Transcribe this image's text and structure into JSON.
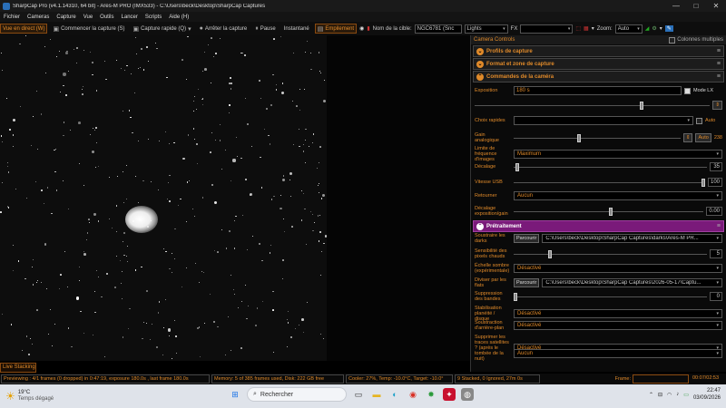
{
  "titlebar": {
    "title": "SharpCap Pro (v4.1.14310, 64 bit) - Ares-M PRO (IMX533) - C:\\Users\\beck\\Desktop\\SharpCap Captures",
    "minimize": "—",
    "maximize": "□",
    "close": "✕"
  },
  "menu": [
    "Fichier",
    "Cameras",
    "Capture",
    "Vue",
    "Outils",
    "Lancer",
    "Scripts",
    "Aide (H)"
  ],
  "toolbar": {
    "live": "Vue en direct (W)",
    "start": "Commencer la capture (S)",
    "quick": "Capture rapide (Q)",
    "stop": "Arrêter la capture",
    "pause": "Pause",
    "snapshot": "Instantané",
    "stack": "Empilement",
    "target_label": "Nom de la cible:",
    "target_value": "NGC6781 (Snc",
    "frame_type": "Lights",
    "fx_label": "FX",
    "zoom_label": "Zoom:",
    "zoom_value": "Auto"
  },
  "panel": {
    "title": "Camera Controls",
    "multi": "Colonnes multiples",
    "sections": {
      "profiles": "Profils de capture",
      "format": "Format et zone de capture",
      "camera": "Commandes de la caméra",
      "preproc": "Prétraitement"
    },
    "camera": {
      "exposure_label": "Exposition",
      "exposure_value": "180 s",
      "lx_label": "Mode LX",
      "quick_label": "Choix rapides",
      "auto_label": "Auto",
      "gain_label": "Gain analogique",
      "gain_auto": "Auto",
      "gain_value": "238",
      "framerate_label": "Limite de fréquence d'images",
      "framerate_value": "Maximum",
      "offset_label": "Décalage",
      "offset_value": "35",
      "usb_label": "Vitesse USB",
      "usb_value": "100",
      "flip_label": "Retourner",
      "flip_value": "Aucun",
      "expgain_label": "Décalage exposition/gain",
      "expgain_value": "0.00"
    },
    "preproc": {
      "darks_label": "Soustraire les darks",
      "darks_btn": "Parcourir",
      "darks_path": "C:\\Users\\beck\\Desktop\\SharpCap Captures\\darks\\Ares-M PR...",
      "hotpix_label": "Sensibilité des pixels chauds",
      "hotpix_value": "5",
      "darkscale_label": "Échelle sombre (expérimentale)",
      "darkscale_value": "Désactivé",
      "flats_label": "Diviser par les flats",
      "flats_btn": "Parcourir",
      "flats_path": "C:\\Users\\beck\\Desktop\\SharpCap Captures\\2026-05-17\\Captu...",
      "banding_label": "Suppression des bandes",
      "banding_value": "0",
      "flatness_label": "Stabilisation planéité / disque",
      "flatness_value": "Désactivé",
      "bg_label": "Soustraction d'arrière-plan",
      "bg_value": "Désactivé",
      "sat_label": "Supprimer les traces satellites ? (après le tombée de la nuit)",
      "sat_value": "Désactivé",
      "last_value": "Aucun"
    }
  },
  "livestack": "Live Stacking",
  "status": {
    "preview": "Previewing : 4/1 frames (0 dropped) in 0:47:19, exposure 180.0s , last frame 180.0s",
    "memory": "Memory: 5 of 385 frames used, Disk: 222 GB free",
    "cooler": "Cooler: 27%, Temp: -10.0°C, Target: -10.0°",
    "stacked": "9 Stacked, 0 Ignored, 27m 0s",
    "frame_label": "Frame:",
    "frame_time": "00:07/02:53"
  },
  "taskbar": {
    "temp": "19°C",
    "weather": "Temps dégagé",
    "search": "Rechercher",
    "time": "22:47",
    "date": "03/09/2026"
  }
}
